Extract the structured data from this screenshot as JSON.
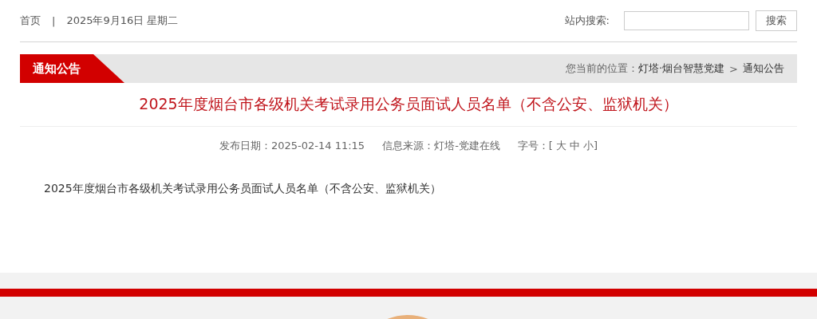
{
  "top_bar": {
    "home_link": "首页",
    "separator": "|",
    "date": "2025年9月16日 星期二",
    "search_label": "站内搜索:",
    "search_button": "搜索"
  },
  "channel_bar": {
    "title": "通知公告",
    "location_label": "您当前的位置：",
    "breadcrumb": [
      "灯塔·烟台智慧党建",
      "通知公告"
    ],
    "breadcrumb_separator": ">"
  },
  "article": {
    "title": "2025年度烟台市各级机关考试录用公务员面试人员名单（不含公安、监狱机关）",
    "publish_date": "发布日期：2025-02-14 11:15",
    "source": "信息来源：灯塔-党建在线",
    "font_size": {
      "label": "字号：",
      "open": "[",
      "sizes": [
        "大",
        "中",
        "小"
      ],
      "close": "]"
    },
    "body": "2025年度烟台市各级机关考试录用公务员面试人员名单（不含公安、监狱机关）"
  }
}
